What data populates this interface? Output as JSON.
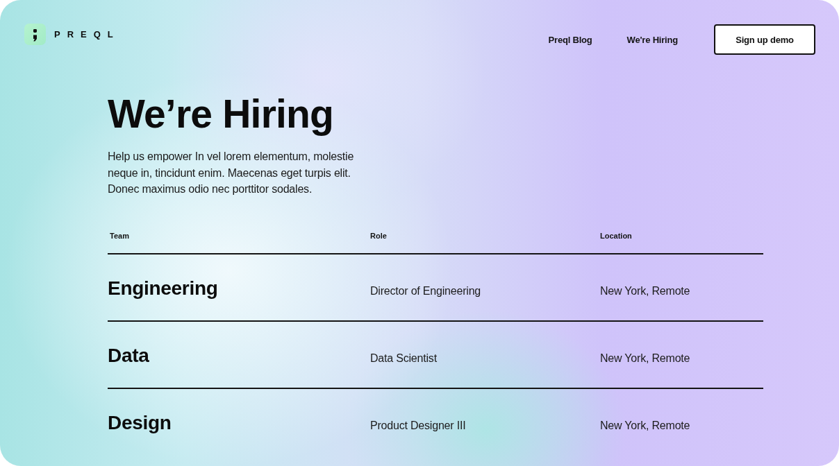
{
  "header": {
    "brand": "PREQL",
    "nav_links": [
      {
        "label": "Preql Blog"
      },
      {
        "label": "We're Hiring"
      }
    ],
    "cta_button": "Sign up demo"
  },
  "hero": {
    "title": "We’re Hiring",
    "description": "Help us empower In vel lorem elementum, molestie neque in, tincidunt enim. Maecenas eget turpis elit. Donec maximus odio nec porttitor sodales."
  },
  "table": {
    "columns": [
      "Team",
      "Role",
      "Location"
    ],
    "rows": [
      {
        "team": "Engineering",
        "role": "Director of Engineering",
        "location": "New York, Remote"
      },
      {
        "team": "Data",
        "role": "Data Scientist",
        "location": "New York, Remote"
      },
      {
        "team": "Design",
        "role": "Product Designer III",
        "location": "New York, Remote"
      }
    ]
  }
}
